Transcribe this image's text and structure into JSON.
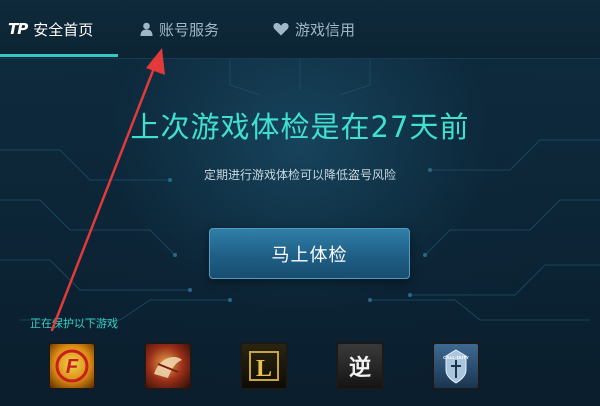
{
  "tabs": [
    {
      "label": "安全首页",
      "icon": "tp-logo-icon",
      "active": true
    },
    {
      "label": "账号服务",
      "icon": "user-icon",
      "active": false
    },
    {
      "label": "游戏信用",
      "icon": "heart-icon",
      "active": false
    }
  ],
  "logo_text": "TP",
  "main": {
    "headline": "上次游戏体检是在27天前",
    "subline": "定期进行游戏体检可以降低盗号风险",
    "check_button": "马上体检"
  },
  "protected": {
    "label": "正在保护以下游戏",
    "games": [
      {
        "name": "crossfire-logo",
        "text": "F"
      },
      {
        "name": "tiantian-logo",
        "text": ""
      },
      {
        "name": "league-of-legends-logo",
        "text": "L"
      },
      {
        "name": "ni-logo",
        "text": "逆"
      },
      {
        "name": "call-of-duty-logo",
        "text": "CALL·DUTY"
      }
    ]
  },
  "colors": {
    "accent": "#3fe0cf",
    "annotation_arrow": "#e23a3a",
    "button": "#1f5f86"
  }
}
